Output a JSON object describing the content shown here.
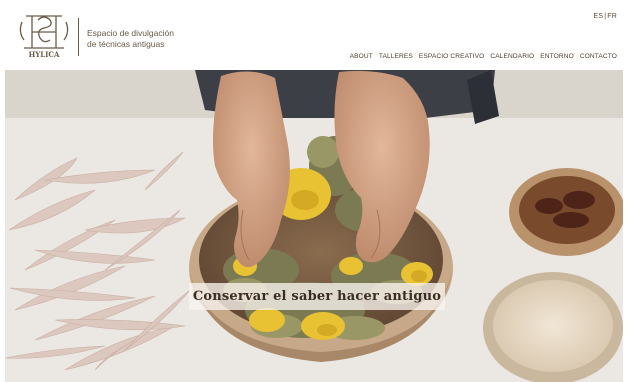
{
  "brand": {
    "logo_icon": "hylica-monogram-logo",
    "logo_text": "HYLICA",
    "tagline_line1": "Espacio de divulgación",
    "tagline_line2": "de técnicas antiguas"
  },
  "language": {
    "es": "ES",
    "separator": "|",
    "fr": "FR"
  },
  "nav": {
    "items": [
      {
        "label": "ABOUT"
      },
      {
        "label": "TALLERES"
      },
      {
        "label": "ESPACIO CREATIVO"
      },
      {
        "label": "CALENDARIO"
      },
      {
        "label": "ENTORNO"
      },
      {
        "label": "CONTACTO"
      }
    ]
  },
  "hero": {
    "caption": "Conservar el saber hacer antiguo",
    "image_subject": "hands-holding-bowl-of-dried-yarrow-photo"
  },
  "colors": {
    "text_brown": "#5a4a3a",
    "caption_bg": "#f8f4ee",
    "yarrow_yellow": "#e8c233",
    "bowl_wood": "#b89878"
  }
}
